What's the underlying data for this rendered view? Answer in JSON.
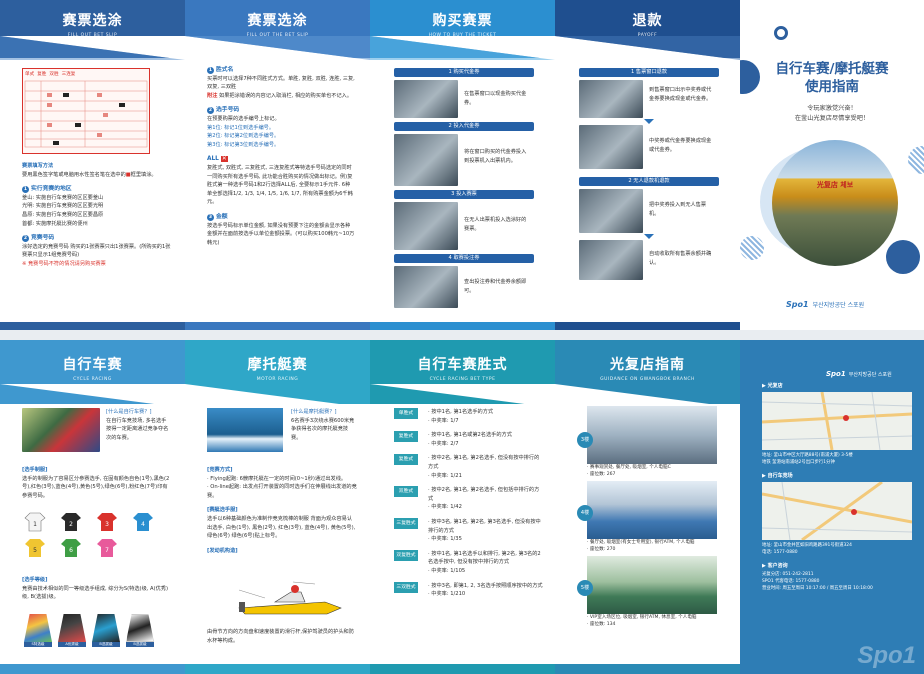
{
  "panels_top": {
    "p1": {
      "title": "赛票选涂",
      "subtitle": "FILL OUT BET SLIP",
      "ticket_rows": [
        "单式",
        "复胜",
        "双胜",
        "三连复"
      ],
      "method_title": "赛票填写方法",
      "method_text1": "要用黑色签字笔或电脑用水性签名笔在选中的",
      "method_text2": "框里填涂。",
      "sec1_title": "实行竞赛的地区",
      "sec1_lines": [
        "釜山: 实施自行车竞赛的区区要釜山",
        "光明: 实施自行车竞赛的区区要光明",
        "昌原: 实施自行车竞赛的区区要昌原",
        "首都: 实施摩托艇比赛的便州"
      ],
      "sec2_title": "竞赛号码",
      "sec2_text": "涂好选定的竞赛号码 购买的1张赛票只出1张赛票。(所购买的1张赛票只显示1组竞赛号码)",
      "sec2_note": "※ 竞赛号码不符的情况请另购买赛票"
    },
    "p2": {
      "title": "赛票选涂",
      "subtitle": "FILL OUT THE BET SLIP",
      "s1_title": "胜式名",
      "s1_text": "买票时可以选择7种不同胜式方式。单胜, 复胜, 双胜, 连胜, 三复, 双复, 三双胜",
      "s1_note_label": "附注",
      "s1_note": "如果把涂错误的内容记入取消栏, 相应的购买单也不记入。",
      "s2_title": "选手号码",
      "s2_text": "在预要购票的选手编号上标记。",
      "s2_lines": [
        "第1位: 标记1位到选手编号。",
        "第2位: 标记第2位到选手编号。",
        "第3位: 标记第3位到选手编号。"
      ],
      "s3_title": "ALL",
      "s3_text": "复胜式, 双胜式, 三复胜式, 三连复胜式等特选手号码选定的同时一同购买所有选手号码, 此功能合胜购买的情况做出标记。例)复胜式第一种选手号码1和2行选择ALL后, 全要标示1手元件. 6种单全部选择1/2, 1/3, 1/4, 1/5, 1/6, 1/7, 所有购票金额为6千韩元。",
      "s4_title": "金额",
      "s4_text": "按选手号码标示单位金额, 如果没有预要下注的金额会显示各种金额并在面前按选手以单位金额投票。(可以购买100韩元~10万韩元)"
    },
    "p3": {
      "title": "购买赛票",
      "subtitle": "HOW TO BUY THE TICKET",
      "steps": [
        {
          "label": "1 购买代金券",
          "text": "在售票窗口以现金购买代金券。"
        },
        {
          "label": "2 投入代金券",
          "text": "将在窗口购买的代金券投入到投票机入出票机内。"
        },
        {
          "label": "3 投入赛票",
          "text": "在无人出票机投入选涂好的赛票。"
        },
        {
          "label": "4 取赛投注券",
          "text": "查出投注券和代金券余额即可。"
        }
      ]
    },
    "p4": {
      "title": "退款",
      "subtitle": "PAYOFF",
      "steps": [
        {
          "label": "1 售票窗口退款",
          "text": "到售票窗口出示中奖券或代金券要换成现金或代金券。"
        },
        {
          "label": "",
          "text": "中奖券或代金券要换成现金或代金券。"
        },
        {
          "label": "2 无人退款机退款",
          "text": "把中奖券投入到无人售票机。"
        },
        {
          "label": "",
          "text": "自动收取所有售票余额并确认。"
        }
      ]
    },
    "cover": {
      "title_line1": "自行车赛/摩托艇赛",
      "title_line2": "使用指南",
      "welcome1": "令玩家激觉兴奋！",
      "welcome2": "在釜山光复店尽情享受吧！",
      "store_sign": "光复店 체보",
      "brand_text": "부산지방공단 스포원"
    }
  },
  "panels_bottom": {
    "b1": {
      "title": "自行车赛",
      "subtitle": "CYCLE RACING",
      "q_title": "[什么是自行车赛？]",
      "q_text": "在自行车竞技场, 多名选手按得一定距离通过竞争夺名次的车赛。",
      "sec1_title": "[选手制服]",
      "sec1_text": "选手的制服为了容易区分参赛选手, 在固有颜色自色(1号),黑色(2号),红色(3号),蓝色(4号),黄色(5号),绿色(6号),粉红色(7号)印有参赛号码。",
      "jersey_numbers": [
        "1",
        "2",
        "3",
        "4",
        "5",
        "6",
        "7"
      ],
      "sec2_title": "[选手等级]",
      "sec2_text": "竞赛由技术相似的同一等级选手组成, 综分为S(特选)级, A(优秀)级, B(选拔)级。",
      "grades": [
        "S特选级",
        "A优秀级",
        "B选拔级",
        "B选拔级"
      ]
    },
    "b2": {
      "title": "摩托艇赛",
      "subtitle": "MOTOR RACING",
      "q_title": "[什么是摩托艇赛？]",
      "q_text": "6名赛手3次绕水赛600米竞争获得名次的摩托艇竞技赛。",
      "sec1_title": "[竞赛方式]",
      "sec1_lines": [
        "· Flying起跑: 6艘摩托艇在一定的时间(0~1秒)通过出发线。",
        "· On-line起跑: 出发点打开装置的同时选手们在伸展线出发道的竞赛。"
      ],
      "sec2_title": "[赛艇选手服]",
      "sec2_text": "选手以6种基础颜色为准制作竞克梳棒的制服 背面为观众容易认出选手, 白色(1号), 黑色(2号), 红色(3号), 蓝色(4号), 黄色(5号), 绿色(6号) 绿色(6号)贴上标号。",
      "sec3_title": "[发动机构造]",
      "caption": "由骨节方向的方向盘和速度装置的滑行杆,保护驾驶员的护头和防水杯等构成。"
    },
    "b3": {
      "title": "自行车赛胜式",
      "subtitle": "CYCLE RACING BET TYPE",
      "bets": [
        {
          "tag": "单胜式",
          "l1": "· 按中1名,  第1名选手的方式",
          "l2": "· 中奖率: 1/7"
        },
        {
          "tag": "复胜式",
          "l1": "· 按中1名,  第1名或第2名选手的方式",
          "l2": "· 中奖率: 2/7"
        },
        {
          "tag": "复胜式",
          "l1": "· 按中2名, 第1名, 第2名选手, 但没有按中排行的方式",
          "l2": "· 中奖率: 1/21"
        },
        {
          "tag": "双胜式",
          "l1": "· 按中2名, 第1名, 第2名选手, 但包括中排行的方式",
          "l2": "· 中奖率: 1/42"
        },
        {
          "tag": "三复胜式",
          "l1": "· 按中3名, 第1名, 第2名, 第3名选手, 但没有按中排行的方式",
          "l2": "· 中奖率: 1/35"
        },
        {
          "tag": "双复胜式",
          "l1": "· 按中1名, 第1名选手以和排行, 第2名, 第3名的2名选手按中, 但没有按中排行的方式",
          "l2": "· 中奖率: 1/105"
        },
        {
          "tag": "三双胜式",
          "l1": "· 按中3名, 即第1, 2, 3名选手按照顺序按中的方式",
          "l2": "· 中奖率: 1/210"
        }
      ]
    },
    "b4": {
      "title": "光复店指南",
      "subtitle": "GUIDANCE ON GWANGBOK BRANCH",
      "floors": [
        {
          "tag": "3楼",
          "l1": "· 赛事观赏处, 餐厅处, 吸烟室, 个人电脑C",
          "l2": "· 座位数: 267"
        },
        {
          "tag": "4楼",
          "l1": "· 餐厅处, 吸烟室(有女士专用室), 银行ATM, 个人电脑",
          "l2": "· 座位数: 270"
        },
        {
          "tag": "5楼",
          "l1": "· VIP室入场区位, 吸烟室, 银行ATM, 休息室, 个人电脑",
          "l2": "· 座位数: 134"
        }
      ]
    },
    "b5": {
      "brand_text": "부산지방공단 스포원",
      "sec1_title": "▶ 光复店",
      "addr1": "地址: 釜山市中区大厅路88号(南浦大厦) 3-5楼",
      "transport1": "地铁 釜港站南浦站2号出口步行1分钟",
      "sec2_title": "▶ 自行车竞场",
      "addr2": "地址: 釜山市金井区如旧鸡路路391号街道324",
      "phone2": "电话: 1577-0880",
      "sec3_title": "▶ 客户咨询",
      "contact1": "光复分店: 051-242-2811",
      "contact2": "SPO1 代客电话: 1577-0880",
      "contact3": "营业时间: 周五至周日 10:17:00 / 周五至周日 10:18:00",
      "footer_logo": "Spo1"
    }
  }
}
